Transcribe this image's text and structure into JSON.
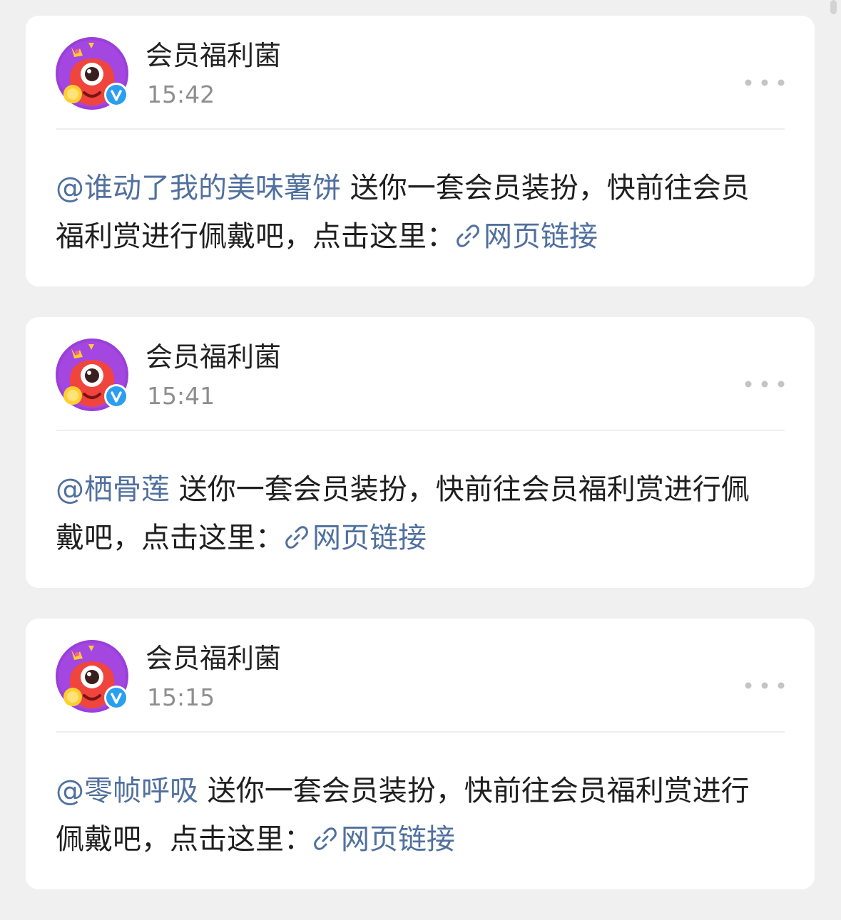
{
  "feed": {
    "posts": [
      {
        "author": "会员福利菌",
        "time": "15:42",
        "mention": "@谁动了我的美味薯饼",
        "text": " 送你一套会员装扮，快前往会员福利赏进行佩戴吧，点击这里：",
        "link_label": "网页链接"
      },
      {
        "author": "会员福利菌",
        "time": "15:41",
        "mention": "@栖骨莲",
        "text": " 送你一套会员装扮，快前往会员福利赏进行佩戴吧，点击这里：",
        "link_label": "网页链接"
      },
      {
        "author": "会员福利菌",
        "time": "15:15",
        "mention": "@零帧呼吸",
        "text": " 送你一套会员装扮，快前往会员福利赏进行佩戴吧，点击这里：",
        "link_label": "网页链接"
      }
    ]
  },
  "icons": {
    "avatar": "red-monster-avatar",
    "verified": "verified-v-icon",
    "more": "more-dots-icon",
    "link": "link-icon"
  },
  "colors": {
    "link": "#50709e",
    "verified": "#2a9ff0",
    "background": "#f0f0f0"
  }
}
